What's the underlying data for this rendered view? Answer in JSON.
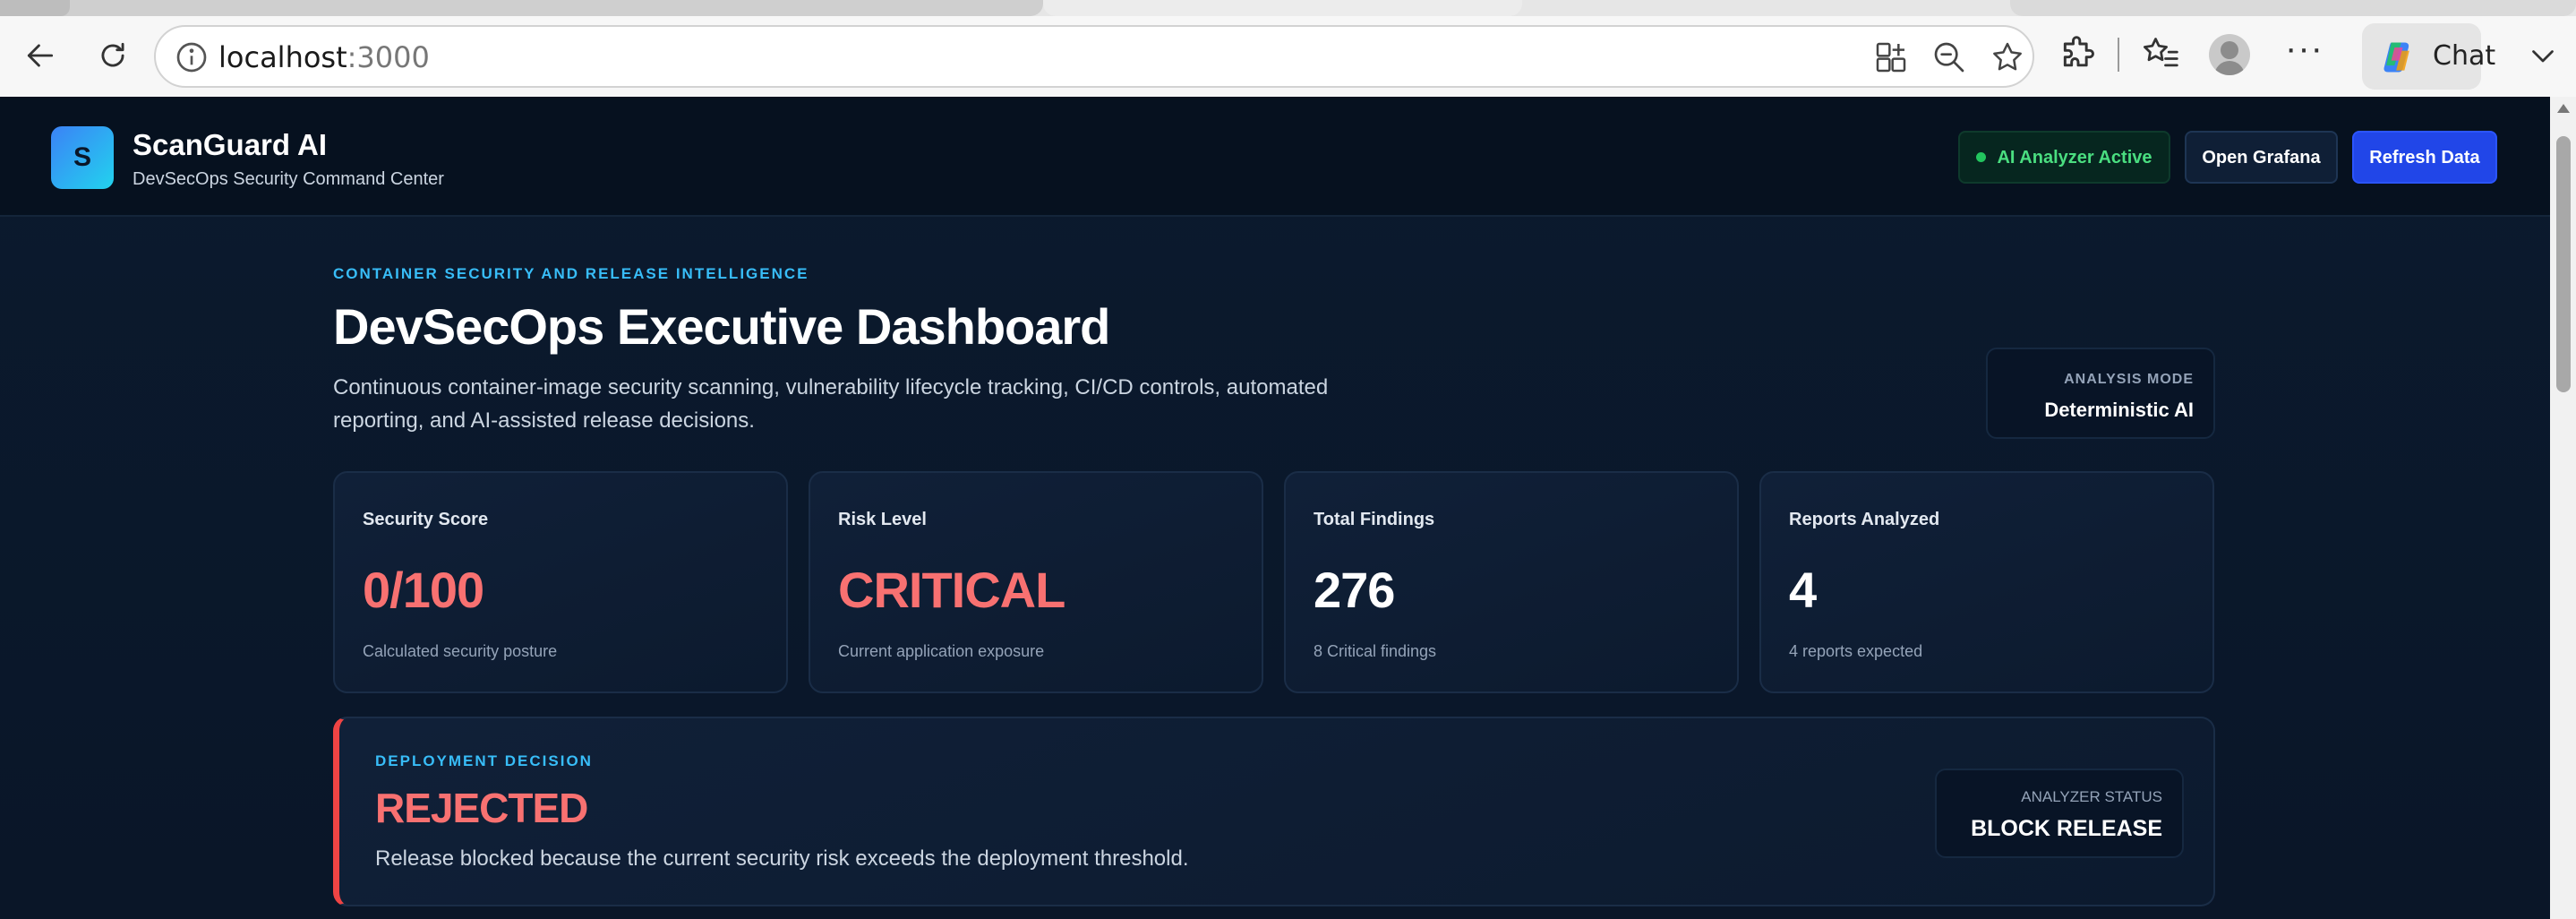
{
  "browser": {
    "url_host": "localhost",
    "url_port": ":3000",
    "chat_label": "Chat",
    "more_label": "···",
    "icons": [
      "back-icon",
      "reload-icon",
      "site-info-icon",
      "add-tab-group-icon",
      "zoom-out-icon",
      "favorite-star-icon",
      "extensions-icon",
      "favorites-list-icon",
      "profile-avatar-icon",
      "more-options-icon",
      "copilot-icon",
      "chevron-down-icon"
    ]
  },
  "header": {
    "logo_letter": "S",
    "brand_name": "ScanGuard AI",
    "brand_subtitle": "DevSecOps Security Command Center",
    "ai_status_label": "AI Analyzer Active",
    "grafana_label": "Open Grafana",
    "refresh_label": "Refresh Data"
  },
  "hero": {
    "eyebrow": "CONTAINER SECURITY AND RELEASE INTELLIGENCE",
    "title": "DevSecOps Executive Dashboard",
    "description": "Continuous container-image security scanning, vulnerability lifecycle tracking, CI/CD controls, automated reporting, and AI-assisted release decisions.",
    "mode_label": "ANALYSIS MODE",
    "mode_value": "Deterministic AI"
  },
  "metrics": [
    {
      "label": "Security Score",
      "value": "0/100",
      "sub": "Calculated security posture"
    },
    {
      "label": "Risk Level",
      "value": "CRITICAL",
      "sub": "Current application exposure"
    },
    {
      "label": "Total Findings",
      "value": "276",
      "sub": "8 Critical findings"
    },
    {
      "label": "Reports Analyzed",
      "value": "4",
      "sub": "4 reports expected"
    }
  ],
  "decision": {
    "eyebrow": "DEPLOYMENT DECISION",
    "value": "REJECTED",
    "description": "Release blocked because the current security risk exceeds the deployment threshold.",
    "status_label": "ANALYZER STATUS",
    "status_value": "BLOCK RELEASE"
  },
  "colors": {
    "accent_blue": "#2146e8",
    "eyebrow_cyan": "#38bdf8",
    "danger_red": "#f87171",
    "success_green": "#4ade80",
    "background": "#0a1628"
  }
}
